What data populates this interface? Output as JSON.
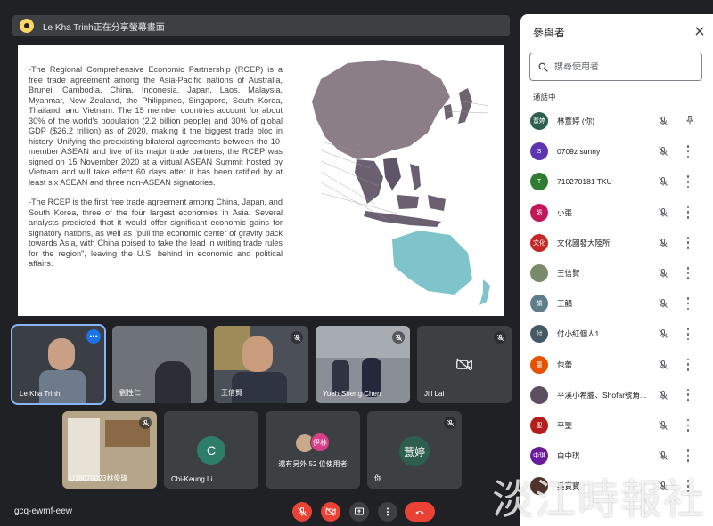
{
  "presenting": {
    "text": "Le Kha Trinh正在分享螢幕畫面"
  },
  "slide": {
    "paragraph1": "-The Regional Comprehensive Economic Partnership (RCEP) is a free trade agreement among the Asia-Pacific nations of Australia, Brunei, Cambodia, China, Indonesia, Japan, Laos, Malaysia, Myanmar, New Zealand, the Philippines, Singapore, South Korea, Thailand, and Vietnam. The 15 member countries account for about 30% of the world's population (2.2 billion people) and 30% of global GDP ($26.2 trillion) as of 2020, making it the biggest trade bloc in history. Unifying the preexisting bilateral agreements between the 10-member ASEAN and five of its major trade partners, the RCEP was signed on 15 November 2020 at a virtual ASEAN Summit hosted by Vietnam and will take effect 60 days after it has been ratified by at least six ASEAN and three non-ASEAN signatories.",
    "paragraph2": "-The RCEP is the first free trade agreement among China, Japan, and South Korea, three of the four largest economies in Asia. Several analysts predicted that it would offer significant economic gains for signatory nations, as well as \"pull the economic center of gravity back towards Asia, with China poised to take the lead in writing trade rules for the region\", leaving the U.S. behind in economic and political affairs."
  },
  "tiles": [
    {
      "name": "Le Kha Trinh",
      "muted": false,
      "active": true,
      "bg": "#3a3f46"
    },
    {
      "name": "劉性仁",
      "muted": false,
      "active": false,
      "bg": "#6d7378"
    },
    {
      "name": "王信賢",
      "muted": true,
      "active": false,
      "bg": "#4a4f58"
    },
    {
      "name": "Yueh-Sheng Chen",
      "muted": true,
      "active": false,
      "bg": "#7d8088"
    },
    {
      "name": "Jill Lai",
      "muted": true,
      "active": false,
      "bg": "#3c4043"
    },
    {
      "name": "U18079023林俊瑋",
      "muted": true,
      "active": false,
      "bg": "#8a7a62"
    },
    {
      "name": "Chi-Keung Li",
      "muted": false,
      "active": false,
      "avatar": "C",
      "avatar_color": "#2e7d6b"
    },
    {
      "name": "還有另外 52 位使用者",
      "muted": false,
      "active": false,
      "avatar": "伊林",
      "avatar_color": "#d93f87"
    },
    {
      "name": "你",
      "muted": true,
      "active": false,
      "avatar": "薏婷",
      "avatar_color": "#2e5e4e"
    }
  ],
  "bottom": {
    "meeting_code": "gcq-ewmf-eew"
  },
  "panel": {
    "title": "參與者",
    "search_placeholder": "搜尋使用者",
    "section": "通話中",
    "participants": [
      {
        "name": "林薏婷 (你)",
        "initials": "薏婷",
        "color": "#2e5e4e",
        "pin": true
      },
      {
        "name": "0709z sunny",
        "initials": "S",
        "color": "#5e35b1"
      },
      {
        "name": "710270181 TKU",
        "initials": "T",
        "color": "#2e7d32"
      },
      {
        "name": "小張",
        "initials": "張",
        "color": "#c2185b"
      },
      {
        "name": "文化國發大陸所",
        "initials": "文化",
        "color": "#c62828"
      },
      {
        "name": "王信賢",
        "initials": "",
        "color": "#7a8a6a"
      },
      {
        "name": "王韻",
        "initials": "韻",
        "color": "#607d8b"
      },
      {
        "name": "付小紅個人1",
        "initials": "付",
        "color": "#455a64"
      },
      {
        "name": "包蕾",
        "initials": "蕾",
        "color": "#e65100"
      },
      {
        "name": "平溪小希臘、Shofar號角...",
        "initials": "",
        "color": "#5d4e60"
      },
      {
        "name": "平聖",
        "initials": "聖",
        "color": "#b71c1c"
      },
      {
        "name": "白中琪",
        "initials": "中琪",
        "color": "#6a1b9a"
      },
      {
        "name": "吳寶寶",
        "initials": "",
        "color": "#4e342e"
      }
    ]
  },
  "watermark": "淡江時報社"
}
